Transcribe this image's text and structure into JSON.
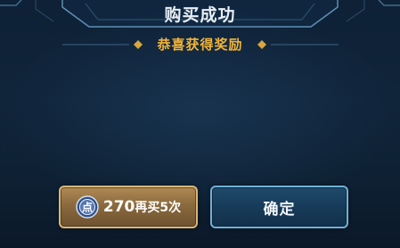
{
  "dialog": {
    "title": "购买成功",
    "subtitle": "恭喜获得奖励"
  },
  "buttons": {
    "buy_again": {
      "price": "270",
      "label": "再买5次",
      "currency_icon": "point-coin-icon",
      "currency_glyph": "点"
    },
    "confirm": {
      "label": "确定"
    }
  },
  "colors": {
    "title": "#e8eef6",
    "subtitle": "#f0b43a",
    "gold_button": "#b08a55",
    "blue_button_border": "#6fb1d6",
    "background": "#0d1b2c"
  }
}
